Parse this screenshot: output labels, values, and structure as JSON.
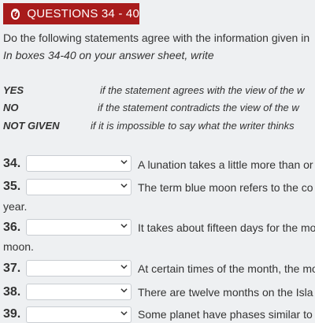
{
  "header": {
    "icon": "question-circle-icon",
    "title": "QUESTIONS 34 - 40"
  },
  "instructions": {
    "line1": "Do the following statements agree with the information given in",
    "line2": "In boxes 34-40 on your answer sheet, write"
  },
  "answer_key": [
    {
      "label": "YES",
      "description": "if the statement agrees with the view of the w"
    },
    {
      "label": "NO",
      "description": "if the statement contradicts the view of the w"
    },
    {
      "label": "NOT GIVEN",
      "description": "if it is impossible to say what the writer thinks"
    }
  ],
  "questions": [
    {
      "number": "34.",
      "selected": "",
      "text": "A lunation takes a little more than or",
      "continuation": ""
    },
    {
      "number": "35.",
      "selected": "",
      "text": "The term blue moon refers to the co",
      "continuation": "year."
    },
    {
      "number": "36.",
      "selected": "",
      "text": "It takes about fifteen days for the mo",
      "continuation": "moon."
    },
    {
      "number": "37.",
      "selected": "",
      "text": "At certain times of the month, the mo",
      "continuation": ""
    },
    {
      "number": "38.",
      "selected": "",
      "text": "There are twelve months on the Isla",
      "continuation": ""
    },
    {
      "number": "39.",
      "selected": "",
      "text": "Some planet have phases similar to",
      "continuation": ""
    }
  ]
}
